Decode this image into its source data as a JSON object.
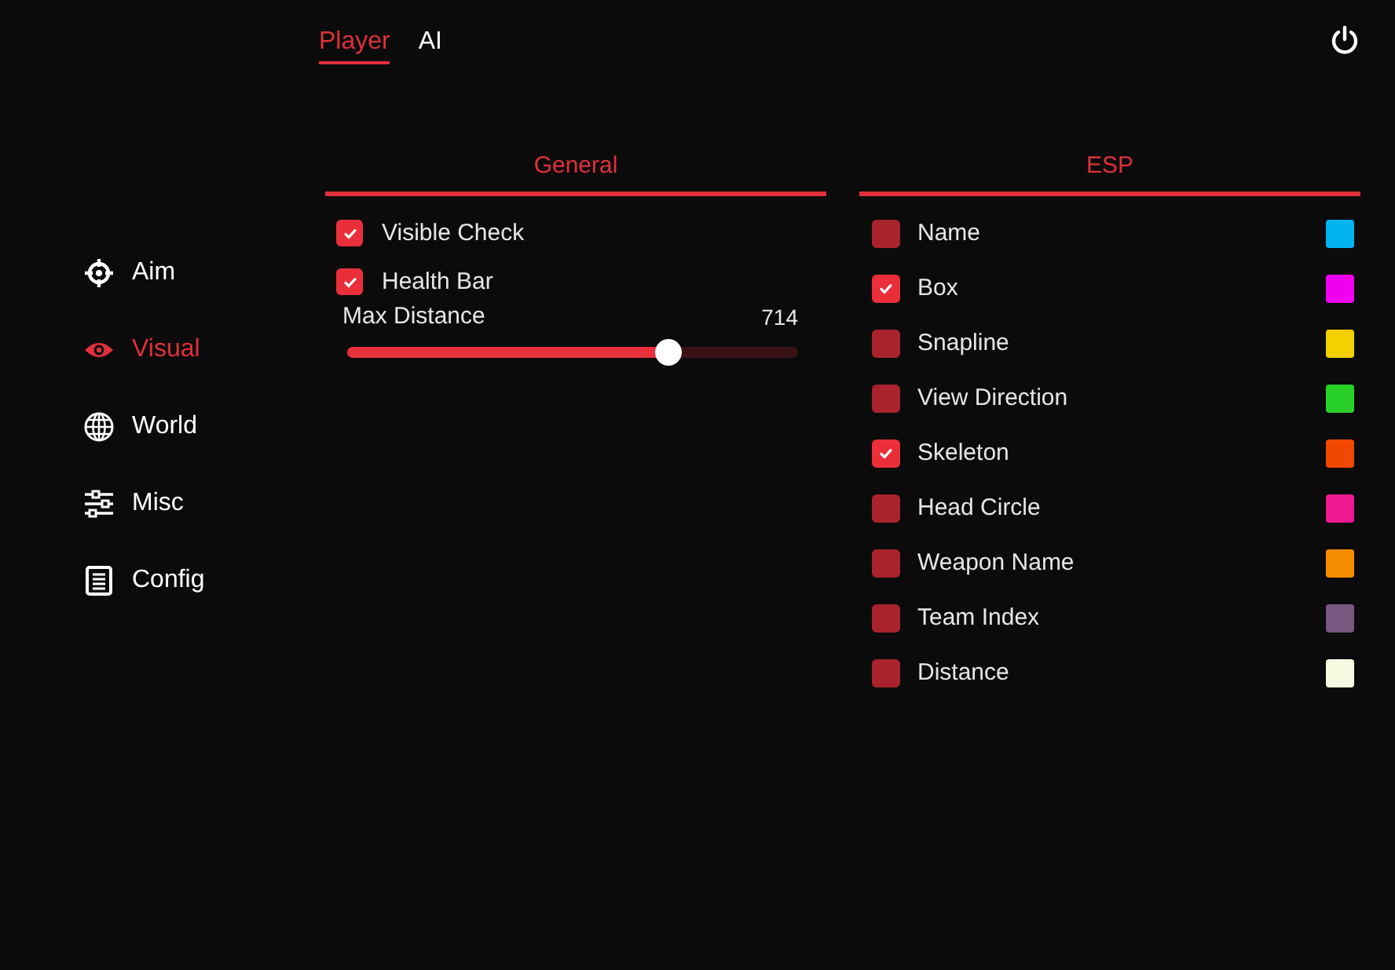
{
  "sidebar": {
    "items": [
      {
        "label": "Aim",
        "selected": false
      },
      {
        "label": "Visual",
        "selected": true
      },
      {
        "label": "World",
        "selected": false
      },
      {
        "label": "Misc",
        "selected": false
      },
      {
        "label": "Config",
        "selected": false
      }
    ]
  },
  "tabs": [
    {
      "label": "Player",
      "selected": true
    },
    {
      "label": "AI",
      "selected": false
    }
  ],
  "general": {
    "title": "General",
    "options": [
      {
        "label": "Visible Check",
        "checked": true
      },
      {
        "label": "Health Bar",
        "checked": true
      }
    ],
    "slider": {
      "label": "Max Distance",
      "reading": "714",
      "level": 0.71
    }
  },
  "esp": {
    "title": "ESP",
    "options": [
      {
        "label": "Name",
        "checked": false,
        "color": "#00b4f0"
      },
      {
        "label": "Box",
        "checked": true,
        "color": "#f000f0"
      },
      {
        "label": "Snapline",
        "checked": false,
        "color": "#f5d000"
      },
      {
        "label": "View Direction",
        "checked": false,
        "color": "#28d028"
      },
      {
        "label": "Skeleton",
        "checked": true,
        "color": "#f04800"
      },
      {
        "label": "Head Circle",
        "checked": false,
        "color": "#f01890"
      },
      {
        "label": "Weapon Name",
        "checked": false,
        "color": "#f58c00"
      },
      {
        "label": "Team Index",
        "checked": false,
        "color": "#785880"
      },
      {
        "label": "Distance",
        "checked": false,
        "color": "#f5fae0"
      }
    ]
  }
}
